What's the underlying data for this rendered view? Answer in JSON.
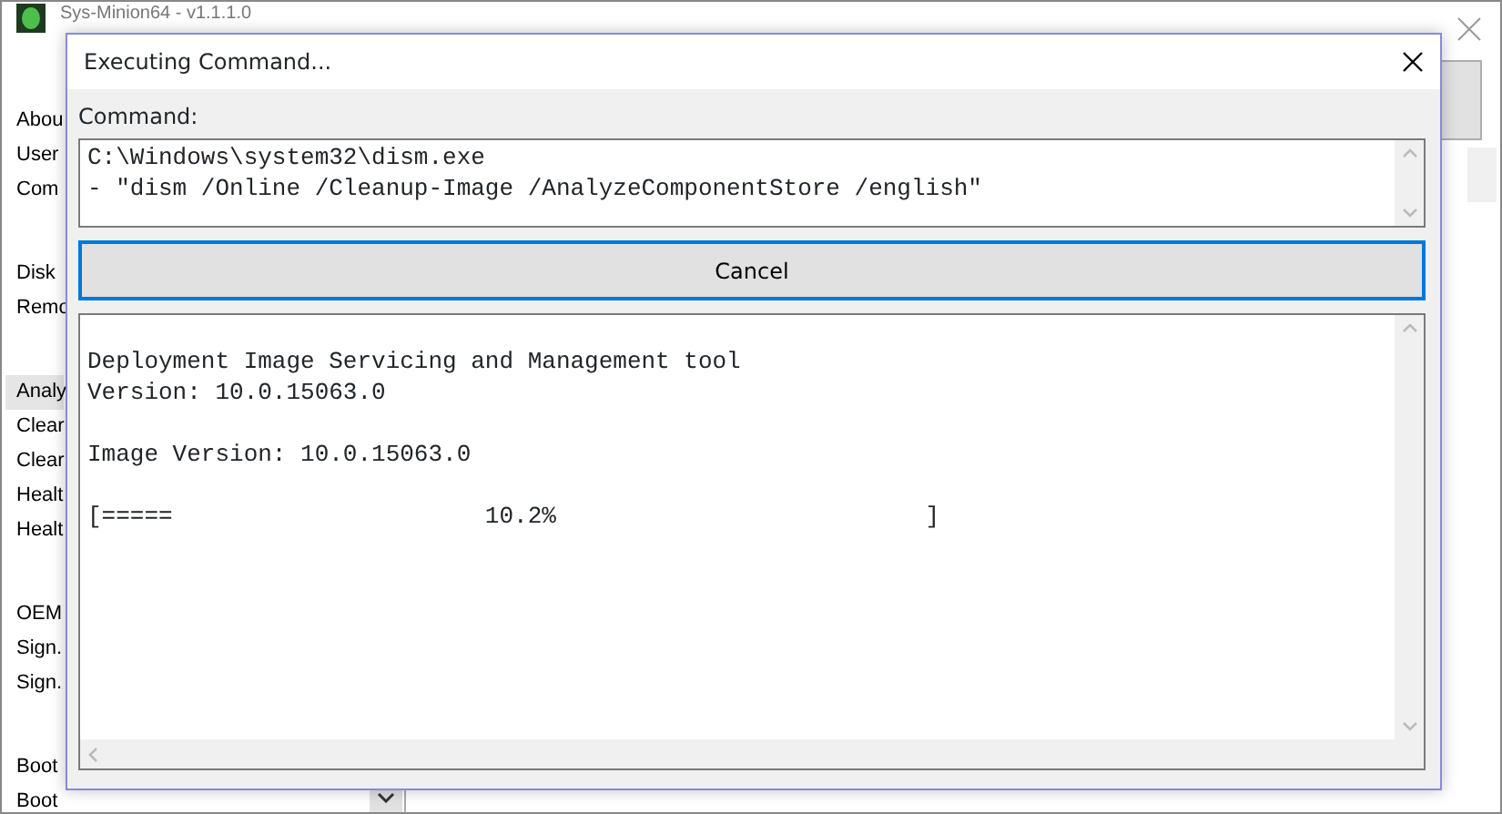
{
  "main_window": {
    "title": "Sys-Minion64 - v1.1.1.0",
    "sidebar": {
      "groups": [
        {
          "items": [
            {
              "label": "Abou",
              "selected": false
            },
            {
              "label": "User",
              "selected": false
            },
            {
              "label": "Com",
              "selected": false
            }
          ]
        },
        {
          "items": [
            {
              "label": "Disk",
              "selected": false
            },
            {
              "label": "Remo",
              "selected": false
            }
          ]
        },
        {
          "items": [
            {
              "label": "Analy",
              "selected": true
            },
            {
              "label": "Clear",
              "selected": false
            },
            {
              "label": "Clear",
              "selected": false
            },
            {
              "label": "Healt",
              "selected": false
            },
            {
              "label": "Healt",
              "selected": false
            }
          ]
        },
        {
          "items": [
            {
              "label": "OEM",
              "selected": false
            },
            {
              "label": "Sign.",
              "selected": false
            },
            {
              "label": "Sign.",
              "selected": false
            }
          ]
        },
        {
          "items": [
            {
              "label": "Boot",
              "selected": false
            },
            {
              "label": "Boot",
              "selected": false
            }
          ]
        }
      ]
    }
  },
  "dialog": {
    "title": "Executing Command...",
    "command_label": "Command:",
    "command_lines": [
      "C:\\Windows\\system32\\dism.exe",
      "- \"dism /Online /Cleanup-Image /AnalyzeComponentStore /english\""
    ],
    "cancel_button": "Cancel",
    "output_paragraphs": [
      [
        "Deployment Image Servicing and Management tool",
        "Version: 10.0.15063.0"
      ],
      [
        "Image Version: 10.0.15063.0"
      ],
      [
        "[=====                      10.2%                          ]"
      ]
    ]
  }
}
